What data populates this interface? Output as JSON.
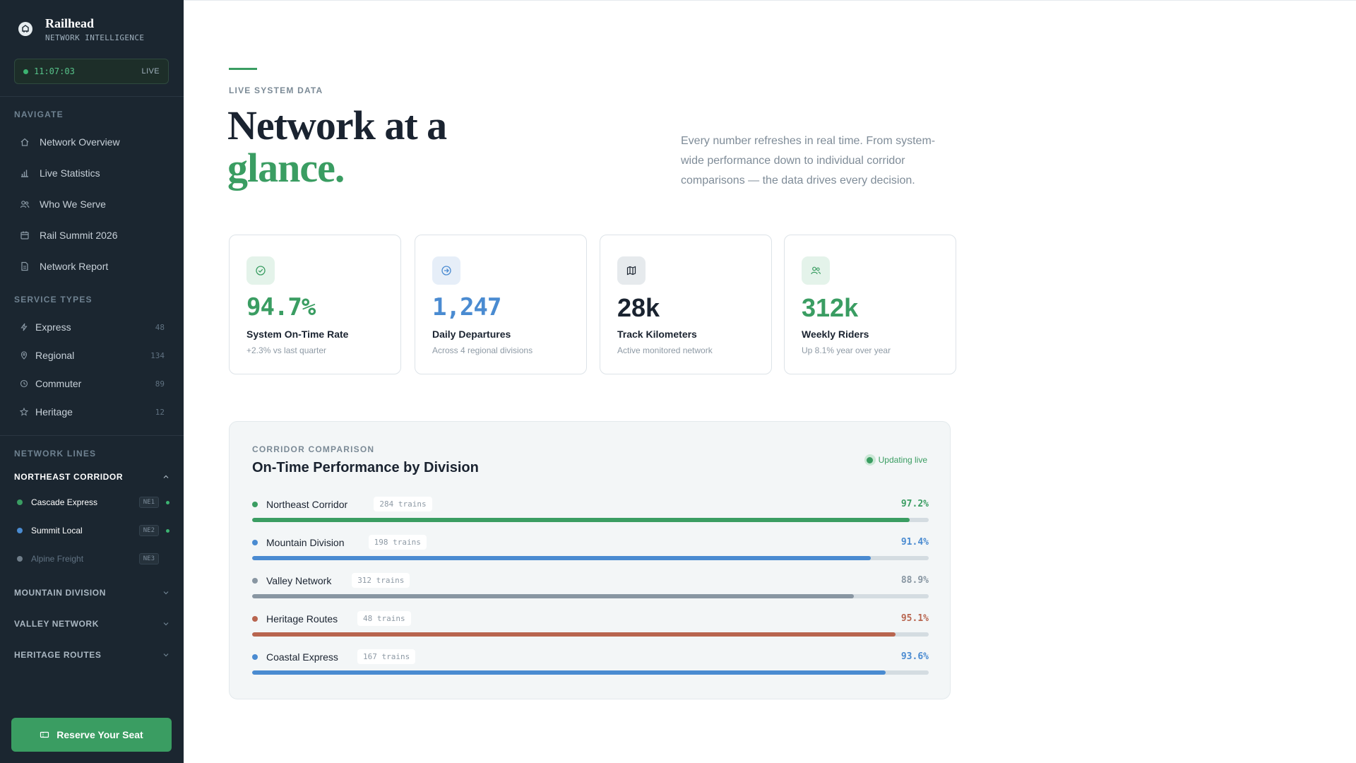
{
  "brand": {
    "title": "Railhead",
    "subtitle": "NETWORK INTELLIGENCE"
  },
  "clock": {
    "time": "11:07:03",
    "status": "LIVE"
  },
  "nav": {
    "label": "NAVIGATE",
    "items": [
      {
        "label": "Network Overview",
        "icon": "home-icon"
      },
      {
        "label": "Live Statistics",
        "icon": "bar-chart-icon"
      },
      {
        "label": "Who We Serve",
        "icon": "users-icon"
      },
      {
        "label": "Rail Summit 2026",
        "icon": "calendar-icon"
      },
      {
        "label": "Network Report",
        "icon": "document-icon"
      }
    ]
  },
  "service_types": {
    "label": "SERVICE TYPES",
    "items": [
      {
        "label": "Express",
        "count": "48",
        "icon": "lightning-icon"
      },
      {
        "label": "Regional",
        "count": "134",
        "icon": "location-pin-icon"
      },
      {
        "label": "Commuter",
        "count": "89",
        "icon": "clock-icon"
      },
      {
        "label": "Heritage",
        "count": "12",
        "icon": "star-icon"
      }
    ]
  },
  "network_lines": {
    "label": "NETWORK LINES",
    "groups": [
      {
        "name": "NORTHEAST CORRIDOR",
        "expanded": true,
        "lines": [
          {
            "name": "Cascade Express",
            "code": "NE1",
            "color": "#3a9d62",
            "active": true
          },
          {
            "name": "Summit Local",
            "code": "NE2",
            "color": "#4a8bd1",
            "active": true
          },
          {
            "name": "Alpine Freight",
            "code": "NE3",
            "color": "#8896a2",
            "active": false
          }
        ]
      },
      {
        "name": "MOUNTAIN DIVISION",
        "expanded": false
      },
      {
        "name": "VALLEY NETWORK",
        "expanded": false
      },
      {
        "name": "HERITAGE ROUTES",
        "expanded": false
      }
    ]
  },
  "cta": {
    "label": "Reserve Your Seat"
  },
  "hero": {
    "eyebrow": "LIVE SYSTEM DATA",
    "title_line1": "Network at a",
    "title_line2": "glance.",
    "description": "Every number refreshes in real time. From system-wide performance down to individual corridor comparisons — the data drives every decision."
  },
  "stats": [
    {
      "value": "94.7%",
      "label": "System On-Time Rate",
      "sub": "+2.3% vs last quarter",
      "color": "#3a9d62",
      "icon": "check-circle-icon"
    },
    {
      "value": "1,247",
      "label": "Daily Departures",
      "sub": "Across 4 regional divisions",
      "color": "#4a8bd1",
      "icon": "arrow-circle-icon"
    },
    {
      "value": "28k",
      "label": "Track Kilometers",
      "sub": "Active monitored network",
      "color": "#1a2330",
      "icon": "map-icon"
    },
    {
      "value": "312k",
      "label": "Weekly Riders",
      "sub": "Up 8.1% year over year",
      "color": "#3a9d62",
      "icon": "users-icon"
    }
  ],
  "corridor": {
    "eyebrow": "CORRIDOR COMPARISON",
    "title": "On-Time Performance by Division",
    "live_label": "Updating live",
    "rows": [
      {
        "name": "Northeast Corridor",
        "trains": "284 trains",
        "pct_label": "97.2%",
        "pct": 97.2,
        "color": "#3a9d62"
      },
      {
        "name": "Mountain Division",
        "trains": "198 trains",
        "pct_label": "91.4%",
        "pct": 91.4,
        "color": "#4a8bd1"
      },
      {
        "name": "Valley Network",
        "trains": "312 trains",
        "pct_label": "88.9%",
        "pct": 88.9,
        "color": "#8896a2"
      },
      {
        "name": "Heritage Routes",
        "trains": "48 trains",
        "pct_label": "95.1%",
        "pct": 95.1,
        "color": "#b8654f"
      },
      {
        "name": "Coastal Express",
        "trains": "167 trains",
        "pct_label": "93.6%",
        "pct": 93.6,
        "color": "#4a8bd1"
      }
    ]
  }
}
